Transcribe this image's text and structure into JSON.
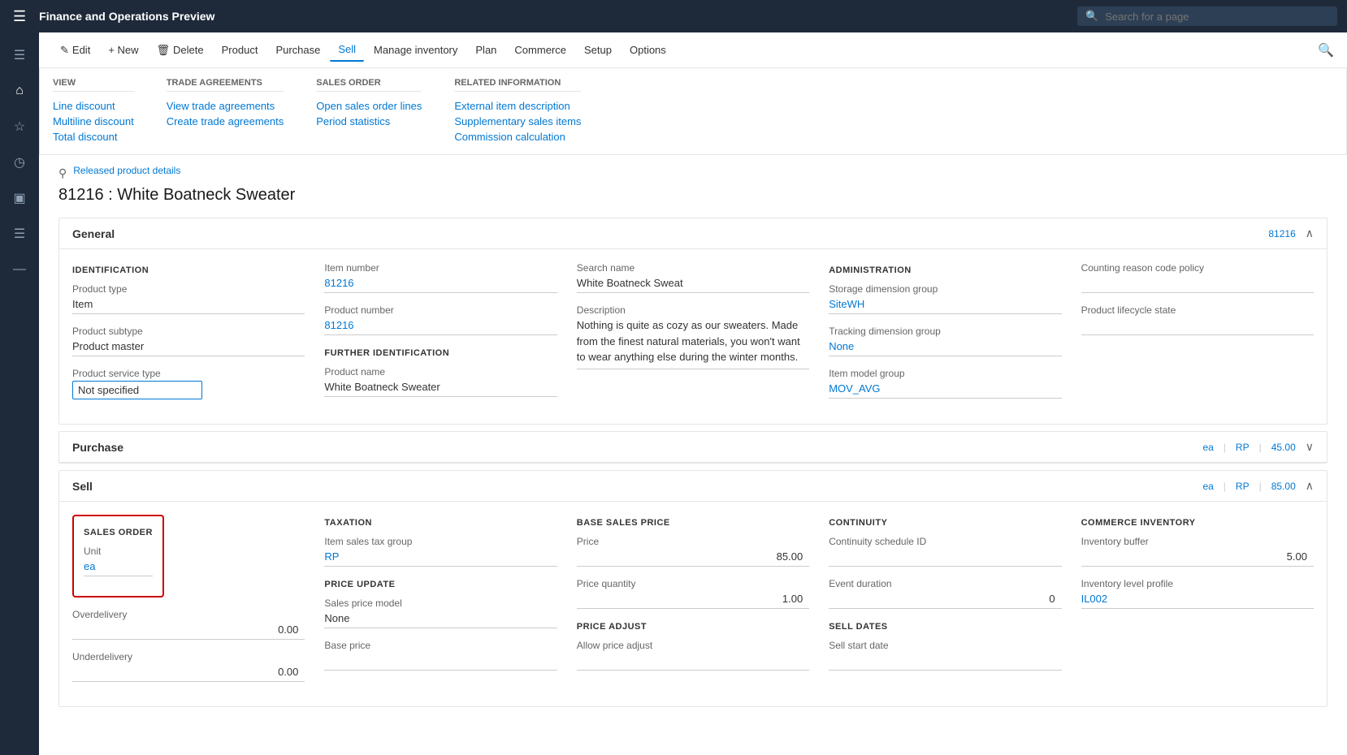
{
  "app": {
    "title": "Finance and Operations Preview"
  },
  "search": {
    "placeholder": "Search for a page"
  },
  "toolbar": {
    "edit_label": "Edit",
    "new_label": "+ New",
    "delete_label": "Delete",
    "product_label": "Product",
    "purchase_label": "Purchase",
    "sell_label": "Sell",
    "manage_inventory_label": "Manage inventory",
    "plan_label": "Plan",
    "commerce_label": "Commerce",
    "setup_label": "Setup",
    "options_label": "Options"
  },
  "dropdown": {
    "view": {
      "title": "View",
      "items": [
        "Line discount",
        "Multiline discount",
        "Total discount"
      ]
    },
    "trade_agreements": {
      "title": "Trade agreements",
      "items": [
        "View trade agreements",
        "Create trade agreements"
      ]
    },
    "sales_order": {
      "title": "Sales order",
      "items": [
        "Open sales order lines",
        "Period statistics"
      ]
    },
    "related_information": {
      "title": "Related information",
      "items": [
        "External item description",
        "Supplementary sales items",
        "Commission calculation"
      ]
    }
  },
  "breadcrumb": "Released product details",
  "page_title": "81216 : White Boatneck Sweater",
  "general_section": {
    "title": "General",
    "badge": "81216",
    "identification": {
      "title": "IDENTIFICATION",
      "product_type_label": "Product type",
      "product_type_value": "Item",
      "product_subtype_label": "Product subtype",
      "product_subtype_value": "Product master",
      "product_service_type_label": "Product service type",
      "product_service_type_value": "Not specified"
    },
    "item_number_label": "Item number",
    "item_number_value": "81216",
    "product_number_label": "Product number",
    "product_number_value": "81216",
    "further_identification": {
      "title": "FURTHER IDENTIFICATION",
      "product_name_label": "Product name",
      "product_name_value": "White Boatneck Sweater"
    },
    "search_name_label": "Search name",
    "search_name_value": "White Boatneck Sweat",
    "description_label": "Description",
    "description_value": "Nothing is quite as cozy as our sweaters. Made from the finest natural materials, you won't want to wear anything else during the winter months.",
    "administration": {
      "title": "ADMINISTRATION",
      "storage_dimension_group_label": "Storage dimension group",
      "storage_dimension_group_value": "SiteWH",
      "tracking_dimension_group_label": "Tracking dimension group",
      "tracking_dimension_group_value": "None",
      "item_model_group_label": "Item model group",
      "item_model_group_value": "MOV_AVG"
    },
    "counting_reason_code_policy_label": "Counting reason code policy",
    "counting_reason_code_policy_value": "",
    "product_lifecycle_state_label": "Product lifecycle state",
    "product_lifecycle_state_value": ""
  },
  "purchase_section": {
    "title": "Purchase",
    "badge1": "ea",
    "badge2": "RP",
    "badge3": "45.00"
  },
  "sell_section": {
    "title": "Sell",
    "badge1": "ea",
    "badge2": "RP",
    "badge3": "85.00",
    "sales_order": {
      "title": "SALES ORDER",
      "unit_label": "Unit",
      "unit_value": "ea",
      "overdelivery_label": "Overdelivery",
      "overdelivery_value": "0.00",
      "underdelivery_label": "Underdelivery",
      "underdelivery_value": "0.00"
    },
    "taxation": {
      "title": "TAXATION",
      "item_sales_tax_group_label": "Item sales tax group",
      "item_sales_tax_group_value": "RP"
    },
    "price_update": {
      "title": "PRICE UPDATE",
      "sales_price_model_label": "Sales price model",
      "sales_price_model_value": "None",
      "base_price_label": "Base price",
      "base_price_value": ""
    },
    "base_sales_price": {
      "title": "BASE SALES PRICE",
      "price_label": "Price",
      "price_value": "85.00",
      "price_quantity_label": "Price quantity",
      "price_quantity_value": "1.00"
    },
    "price_adjust": {
      "title": "PRICE ADJUST",
      "allow_price_adjust_label": "Allow price adjust",
      "allow_price_adjust_value": ""
    },
    "continuity": {
      "title": "CONTINUITY",
      "continuity_schedule_id_label": "Continuity schedule ID",
      "continuity_schedule_id_value": "",
      "event_duration_label": "Event duration",
      "event_duration_value": "0"
    },
    "sell_dates": {
      "title": "SELL DATES",
      "sell_start_date_label": "Sell start date",
      "sell_start_date_value": ""
    },
    "commerce_inventory": {
      "title": "COMMERCE INVENTORY",
      "inventory_buffer_label": "Inventory buffer",
      "inventory_buffer_value": "5.00",
      "inventory_level_profile_label": "Inventory level profile",
      "inventory_level_profile_value": "IL002"
    }
  },
  "sidebar_icons": [
    "≡",
    "⌂",
    "★",
    "⏱",
    "⊞",
    "☰",
    "—"
  ]
}
